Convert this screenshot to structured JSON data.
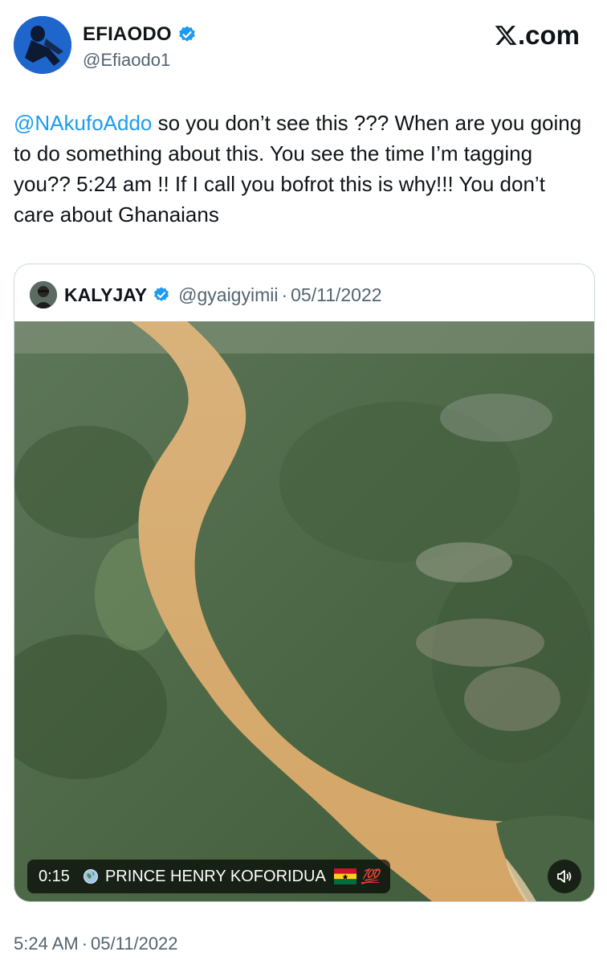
{
  "author": {
    "name": "EFIAODO",
    "handle": "@Efiaodo1",
    "verified": true
  },
  "brand": {
    "label": ".com",
    "logo_icon": "x-logo-icon"
  },
  "tweet": {
    "mention": "@NAkufoAddo",
    "text": " so you don’t see this ??? When are you going to do something about this. You see the time I’m tagging you?? 5:24 am !! If I call you bofrot this is why!!! You don’t care about Ghanaians"
  },
  "quote": {
    "name": "KALYJAY",
    "handle": "@gyaigyimii",
    "separator": "·",
    "date": "05/11/2022",
    "verified": true,
    "video": {
      "duration": "0:15",
      "caption": "PRINCE HENRY KOFORIDUA",
      "emoji_flag": "ghana-flag-icon",
      "emoji_extra": "💯",
      "sound_icon": "speaker-icon"
    }
  },
  "footer": {
    "time": "5:24 AM",
    "separator": "·",
    "date": "05/11/2022"
  },
  "colors": {
    "link": "#1d9bf0",
    "verified": "#1d9bf0",
    "muted": "#536471",
    "river": "#d5a86a",
    "forest": "#4f6a44"
  }
}
